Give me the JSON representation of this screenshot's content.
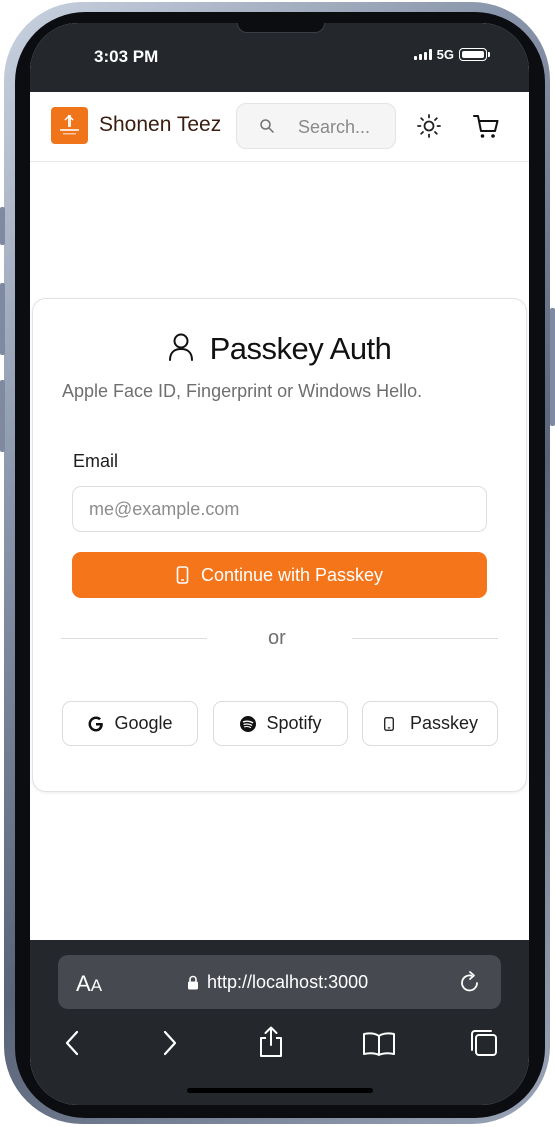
{
  "status_bar": {
    "time": "3:03 PM",
    "network": "5G"
  },
  "header": {
    "brand": "Shonen Teez",
    "search_placeholder": "Search...",
    "brand_color": "#f0741a"
  },
  "auth_card": {
    "title": "Passkey Auth",
    "subtitle": "Apple Face ID, Fingerprint or Windows Hello.",
    "email_label": "Email",
    "email_placeholder": "me@example.com",
    "email_value": "",
    "primary_button": "Continue with Passkey",
    "divider": "or",
    "social_buttons": [
      {
        "label": "Google",
        "icon": "google-icon"
      },
      {
        "label": "Spotify",
        "icon": "spotify-icon"
      },
      {
        "label": "Passkey",
        "icon": "smartphone-icon"
      }
    ],
    "accent_color": "#f5751b"
  },
  "browser": {
    "text_size_label": "AA",
    "url": "http://localhost:3000"
  }
}
